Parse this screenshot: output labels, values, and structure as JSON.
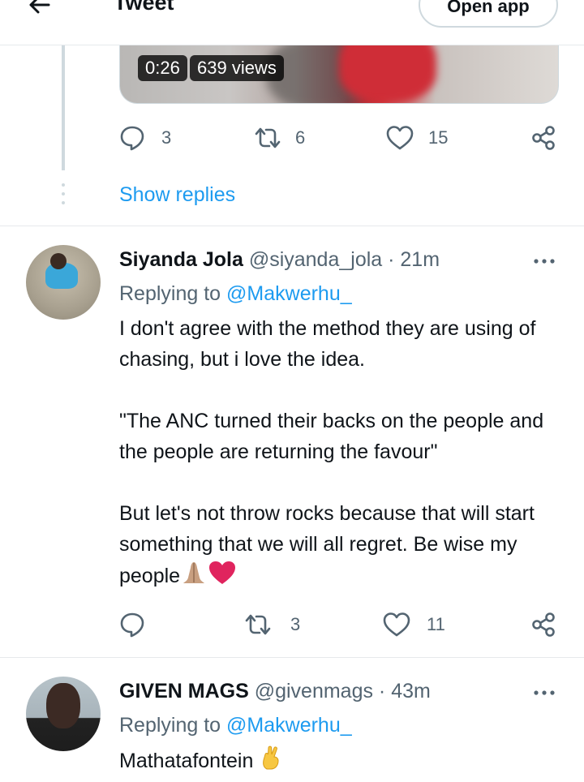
{
  "header": {
    "title": "Tweet",
    "open_app": "Open app"
  },
  "video": {
    "duration": "0:26",
    "views": "639 views"
  },
  "parent_actions": {
    "replies": "3",
    "retweets": "6",
    "likes": "15"
  },
  "show_replies": "Show replies",
  "replies": [
    {
      "name": "Siyanda Jola",
      "meta": "@siyanda_jola · 21m",
      "replying_prefix": "Replying to ",
      "replying_handle": "@Makwerhu_",
      "paragraphs": [
        "I don't agree with the method they are using of chasing, but i love the idea.",
        "\"The ANC turned their backs on the people and the people are returning the favour\"",
        "But let's not throw rocks because that will start something that we will all regret. Be wise my people"
      ],
      "emojis": [
        "folded-hands-emoji",
        "red-heart-emoji"
      ],
      "retweets": "3",
      "likes": "11"
    },
    {
      "name": "GIVEN MAGS",
      "meta": "@givenmags · 43m",
      "replying_prefix": "Replying to ",
      "replying_handle": "@Makwerhu_",
      "text": "Mathatafontein",
      "emojis": [
        "crossed-fingers-emoji"
      ]
    }
  ],
  "colors": {
    "accent": "#1d9bf0",
    "secondary_text": "#536471",
    "like_red": "#e0245e"
  }
}
